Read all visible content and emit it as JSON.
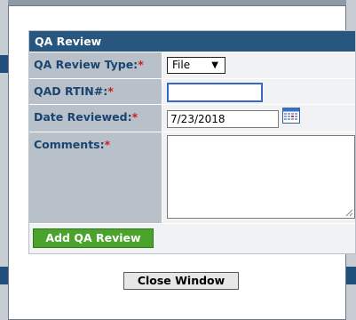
{
  "panel": {
    "title": "QA Review"
  },
  "fields": {
    "review_type": {
      "label": "QA Review Type:",
      "required": "*",
      "value": "File",
      "arrow": "▼"
    },
    "rtin": {
      "label": "QAD RTIN#:",
      "required": "*",
      "value": ""
    },
    "date_reviewed": {
      "label": "Date Reviewed:",
      "required": "*",
      "value": "7/23/2018"
    },
    "comments": {
      "label": "Comments:",
      "required": "*",
      "value": ""
    }
  },
  "buttons": {
    "add": "Add QA Review",
    "close": "Close Window"
  },
  "colors": {
    "header": "#27567f",
    "label_bg": "#b8c1c9",
    "label_text": "#1a4470",
    "required": "#cc1f1f",
    "add_button": "#4aa32a"
  },
  "icons": {
    "calendar": "calendar-icon",
    "dropdown": "chevron-down-icon",
    "resize": "resize-grip-icon"
  }
}
